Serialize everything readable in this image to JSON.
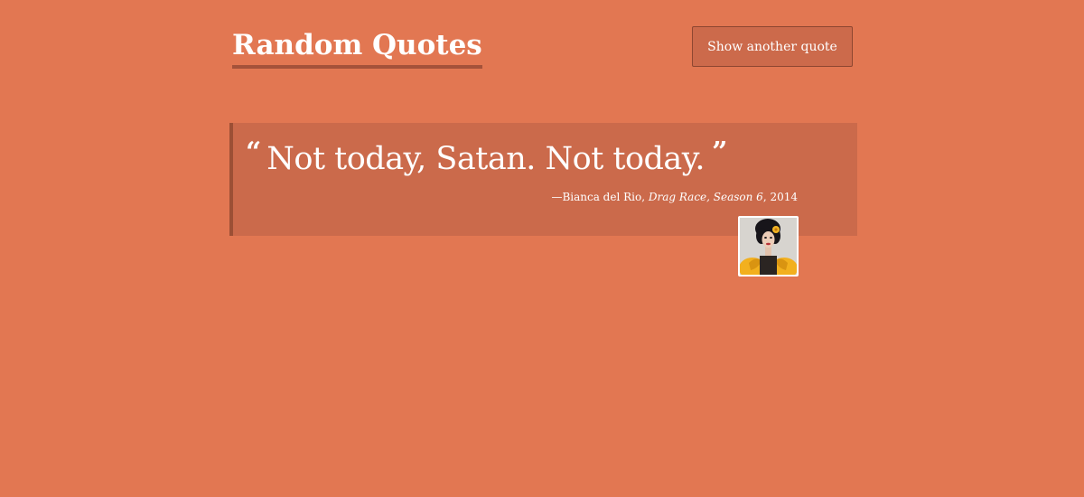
{
  "header": {
    "title": "Random Quotes",
    "button_label": "Show another quote"
  },
  "quote": {
    "open_mark": "“",
    "text": "Not today, Satan. Not today.",
    "close_mark": "”",
    "attribution": {
      "prefix": "—",
      "author": "Bianca del Rio",
      "separator": ", ",
      "source": "Drag Race, Season 6",
      "year_separator": ", ",
      "year": "2014"
    }
  },
  "colors": {
    "background": "#e27752",
    "quote_box": "#cb6a4b",
    "accent_border": "#9c4f35",
    "text": "#ffffff"
  }
}
